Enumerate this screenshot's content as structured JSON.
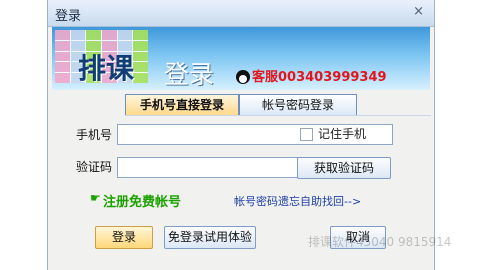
{
  "window": {
    "title": "登录",
    "close_glyph": "×"
  },
  "banner": {
    "big_text": "排课",
    "art_text": "登录",
    "service_text": "客服003403999349"
  },
  "tabs": [
    {
      "label": "手机号直接登录",
      "active": true
    },
    {
      "label": "帐号密码登录",
      "active": false
    }
  ],
  "form": {
    "phone_label": "手机号",
    "remember_label": "记住手机",
    "code_label": "验证码",
    "get_code_label": "获取验证码"
  },
  "links": {
    "register_label": "注册免费帐号",
    "recover_label": "帐号密码遗忘自助找回-->",
    "hand_icon": "☛"
  },
  "buttons": {
    "login_label": "登录",
    "trial_label": "免登录试用体验",
    "cancel_label": "取消"
  },
  "watermark": "排课软件45040 9815914",
  "colors": {
    "accent_green": "#1ca100",
    "accent_red": "#e2161b",
    "accent_blue": "#1e3ea8"
  }
}
